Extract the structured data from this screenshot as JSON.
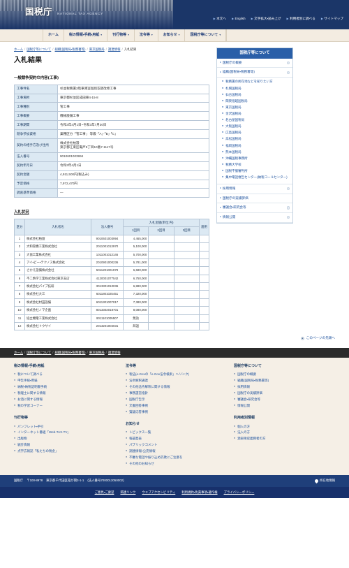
{
  "header": {
    "brand_jp": "国税庁",
    "brand_en": "NATIONAL TAX AGENCY",
    "util_nav": [
      {
        "label": "本文へ"
      },
      {
        "label": "English"
      },
      {
        "label": "文字拡大・読み上げ"
      },
      {
        "label": "利用者別に調べる"
      },
      {
        "label": "サイトマップ"
      }
    ],
    "main_nav": [
      {
        "label": "ホーム",
        "caret": false
      },
      {
        "label": "税の情報・手続・用紙",
        "caret": true
      },
      {
        "label": "刊行物等",
        "caret": true
      },
      {
        "label": "法令等",
        "caret": true
      },
      {
        "label": "お知らせ",
        "caret": true
      },
      {
        "label": "国税庁等について",
        "caret": true
      }
    ]
  },
  "breadcrumb": [
    {
      "label": "ホーム"
    },
    {
      "label": "国税庁等について"
    },
    {
      "label": "組織(国税局・税務署等)"
    },
    {
      "label": "東京国税局"
    },
    {
      "label": "調達情報"
    },
    {
      "label": "入札結果"
    }
  ],
  "main": {
    "page_title": "入札結果",
    "detail_section_title": "一般競争契約の内容(工事)",
    "detail_rows": [
      {
        "label": "工事件名",
        "value": "杉並税務署2階車庫室個別空調改修工事"
      },
      {
        "label": "工事場所",
        "value": "東京都杉並区成田東4-15-8"
      },
      {
        "label": "工事種別",
        "value": "管工事"
      },
      {
        "label": "工事概要",
        "value": "機械設備工事"
      },
      {
        "label": "工事期間",
        "value": "令和3年4月1日~令和3年7月30日"
      },
      {
        "label": "競争参加資格",
        "value": "業種区分「管工事」 等級「A」·「B」·「C」"
      },
      {
        "label": "契約の相手方及び住所",
        "value": "株式会社柏設\n東京都江東区亀戸9丁目10番7-1117号"
      },
      {
        "label": "法人番号",
        "value": "9010601003994"
      },
      {
        "label": "契約年月日",
        "value": "令和3年4月1日"
      },
      {
        "label": "契約金額",
        "value": "4,911,500円(税込み)"
      },
      {
        "label": "予定価格",
        "value": "7,972,470円"
      },
      {
        "label": "調査基準価格",
        "value": "—"
      }
    ],
    "bid_section_title": "入札状況",
    "bid_headers": {
      "ku": "区分",
      "name": "入札者名",
      "hojin": "法人番号",
      "amount_group": "入札金額(単位:円)",
      "round1": "1回目",
      "round2": "2回目",
      "round3": "3回目",
      "apply": "適用"
    },
    "bid_rows": [
      {
        "no": "1",
        "name": "株式会社柏設",
        "hojin": "9010601003994",
        "r1": "4,465,000",
        "r2": "",
        "r3": "",
        "apply": ""
      },
      {
        "no": "2",
        "name": "大和管機工業株式会社",
        "hojin": "2011001013970",
        "r1": "5,100,000",
        "r2": "",
        "r3": "",
        "apply": ""
      },
      {
        "no": "3",
        "name": "大協工業株式会社",
        "hojin": "1011001013146",
        "r1": "5,700,000",
        "r2": "",
        "r3": "",
        "apply": ""
      },
      {
        "no": "4",
        "name": "アイ・ピー・テクノス株式会社",
        "hojin": "2010901000236",
        "r1": "5,781,000",
        "r2": "",
        "r3": "",
        "apply": ""
      },
      {
        "no": "5",
        "name": "さかえ設備株式会社",
        "hojin": "5011201001979",
        "r1": "6,680,000",
        "r2": "",
        "r3": "",
        "apply": ""
      },
      {
        "no": "6",
        "name": "不二熱学工業株式会社東京支店",
        "hojin": "4120001077542",
        "r1": "6,750,000",
        "r2": "",
        "r3": "",
        "apply": ""
      },
      {
        "no": "7",
        "name": "株式会社パイプ技研",
        "hojin": "3013301010036",
        "r1": "6,880,000",
        "r2": "",
        "r3": "",
        "apply": ""
      },
      {
        "no": "8",
        "name": "株式会社大三",
        "hojin": "6011801025451",
        "r1": "7,320,000",
        "r2": "",
        "r3": "",
        "apply": ""
      },
      {
        "no": "9",
        "name": "株式会社村田設備",
        "hojin": "6011301007017",
        "r1": "7,380,000",
        "r2": "",
        "r3": "",
        "apply": ""
      },
      {
        "no": "10",
        "name": "株式会社ノマ企画",
        "hojin": "8013302018701",
        "r1": "8,080,000",
        "r2": "",
        "r3": "",
        "apply": ""
      },
      {
        "no": "11",
        "name": "協立機電工業株式会社",
        "hojin": "9011101005507",
        "r1": "無効",
        "r2": "",
        "r3": "",
        "apply": ""
      },
      {
        "no": "12",
        "name": "株式会社トウサイ",
        "hojin": "2013201004031",
        "r1": "辞退",
        "r2": "",
        "r3": "",
        "apply": ""
      }
    ],
    "pagetop_label": "このページの先頭へ"
  },
  "sidebar": {
    "title": "国税庁等について",
    "links": [
      {
        "label": "国税庁の概要",
        "dot": true
      },
      {
        "label": "組織(国税局・税務署等)",
        "dot": true
      }
    ],
    "org_items": [
      {
        "label": "税務署の所在地などを知りたい方"
      },
      {
        "label": "札幌国税局"
      },
      {
        "label": "仙台国税局"
      },
      {
        "label": "関東信越国税局"
      },
      {
        "label": "東京国税局"
      },
      {
        "label": "金沢国税局"
      },
      {
        "label": "名古屋国税局"
      },
      {
        "label": "大阪国税局"
      },
      {
        "label": "広島国税局"
      },
      {
        "label": "高松国税局"
      },
      {
        "label": "福岡国税局"
      },
      {
        "label": "熊本国税局"
      },
      {
        "label": "沖縄国税事務所"
      },
      {
        "label": "税務大学校"
      },
      {
        "label": "国税不服審判所"
      },
      {
        "label": "集中電話催告センター(納税コールセンター)"
      }
    ],
    "bottom_links": [
      {
        "label": "採用情報",
        "dot": true
      },
      {
        "label": "国税庁の実績評価",
        "dot": false
      },
      {
        "label": "審議会・研究会等",
        "dot": true
      },
      {
        "label": "情報公開",
        "dot": true
      }
    ]
  },
  "footer": {
    "crumbs": [
      {
        "label": "ホーム"
      },
      {
        "label": "国税庁等について"
      },
      {
        "label": "組織(国税局・税務署等)"
      },
      {
        "label": "東京国税局"
      },
      {
        "label": "調達情報"
      }
    ],
    "col1": {
      "head": "税の情報・手続・用紙",
      "items": [
        {
          "label": "税について調べる"
        },
        {
          "label": "申告手続・用紙"
        },
        {
          "label": "納税・納税証明書手続"
        },
        {
          "label": "税理士に関する情報"
        },
        {
          "label": "お酒に関する情報"
        },
        {
          "label": "税の学習コーナー"
        }
      ],
      "head2": "刊行物等",
      "items2": [
        {
          "label": "パンフレット・手引"
        },
        {
          "label": "インターネット番組「Web-TAX-TV」"
        },
        {
          "label": "出版物"
        },
        {
          "label": "統計情報"
        },
        {
          "label": "点字広報誌「私たちの税金」"
        }
      ]
    },
    "col2": {
      "head": "法令等",
      "items": [
        {
          "label": "税法(e-Govの「e-Gov法令検索」へリンク)"
        },
        {
          "label": "法令解釈通達"
        },
        {
          "label": "その他法令解釈に関する情報"
        },
        {
          "label": "事務運営指針"
        },
        {
          "label": "国税庁告示"
        },
        {
          "label": "文書回答事例"
        },
        {
          "label": "質疑応答事例"
        }
      ],
      "head2": "お知らせ",
      "items2": [
        {
          "label": "トピックス一覧"
        },
        {
          "label": "報道発表"
        },
        {
          "label": "パブリックコメント"
        },
        {
          "label": "調達情報・公売情報"
        },
        {
          "label": "不審な電話や振り込め詐欺にご注意を"
        },
        {
          "label": "その他のお知らせ"
        }
      ]
    },
    "col3": {
      "head": "国税庁等について",
      "items": [
        {
          "label": "国税庁の概要"
        },
        {
          "label": "組織(国税局・税務署等)"
        },
        {
          "label": "採用情報"
        },
        {
          "label": "国税庁の実績評価"
        },
        {
          "label": "審議会・研究会等"
        },
        {
          "label": "情報公開"
        }
      ],
      "head2": "利用者別情報",
      "items2": [
        {
          "label": "個人の方"
        },
        {
          "label": "法人の方"
        },
        {
          "label": "源泉徴収義務者の方"
        }
      ]
    },
    "address": {
      "org": "国税庁",
      "postal": "〒100-8978",
      "street": "東京都千代田区霞が関3-1-1",
      "corp_no": "(法人番号7000012050002)",
      "location_link": "所在地情報"
    },
    "bottom_links": [
      {
        "label": "ご意見・ご要望"
      },
      {
        "label": "関連リンク"
      },
      {
        "label": "ウェブアクセシビリティ"
      },
      {
        "label": "利用規約・免責事項・著作権"
      },
      {
        "label": "プライバシーポリシー"
      }
    ]
  }
}
